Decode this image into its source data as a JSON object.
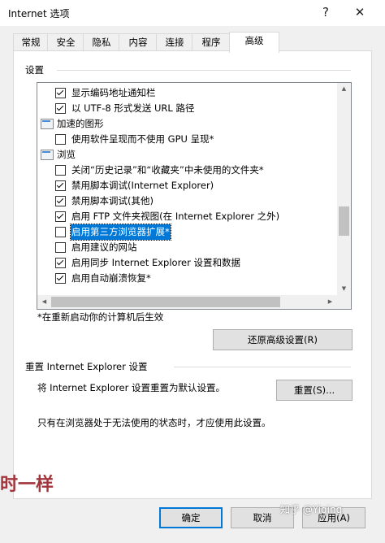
{
  "window": {
    "title": "Internet 选项",
    "help_glyph": "?",
    "close_glyph": "✕"
  },
  "tabs": [
    {
      "label": "常规"
    },
    {
      "label": "安全"
    },
    {
      "label": "隐私"
    },
    {
      "label": "内容"
    },
    {
      "label": "连接"
    },
    {
      "label": "程序"
    },
    {
      "label": "高级",
      "active": true
    }
  ],
  "settings": {
    "group_label": "设置",
    "items": [
      {
        "type": "checkbox",
        "checked": true,
        "label": "显示编码地址通知栏"
      },
      {
        "type": "checkbox",
        "checked": true,
        "label": "以 UTF-8 形式发送 URL 路径"
      },
      {
        "type": "category",
        "label": "加速的图形"
      },
      {
        "type": "checkbox",
        "checked": false,
        "label": "使用软件呈现而不使用 GPU 呈现*"
      },
      {
        "type": "category",
        "label": "浏览"
      },
      {
        "type": "checkbox",
        "checked": false,
        "label": "关闭“历史记录”和“收藏夹”中未使用的文件夹*"
      },
      {
        "type": "checkbox",
        "checked": true,
        "label": "禁用脚本调试(Internet Explorer)"
      },
      {
        "type": "checkbox",
        "checked": true,
        "label": "禁用脚本调试(其他)"
      },
      {
        "type": "checkbox",
        "checked": true,
        "label": "启用 FTP 文件夹视图(在 Internet Explorer 之外)"
      },
      {
        "type": "checkbox",
        "checked": false,
        "label": "启用第三方浏览器扩展*",
        "selected": true
      },
      {
        "type": "checkbox",
        "checked": false,
        "label": "启用建议的网站"
      },
      {
        "type": "checkbox",
        "checked": true,
        "label": "启用同步 Internet Explorer 设置和数据"
      },
      {
        "type": "checkbox",
        "checked": true,
        "label": "启用自动崩溃恢复*"
      }
    ],
    "restart_note": "*在重新启动你的计算机后生效",
    "restore_button": "还原高级设置(R)"
  },
  "reset": {
    "group_label": "重置 Internet Explorer 设置",
    "description": "将 Internet Explorer 设置重置为默认设置。",
    "reset_button": "重置(S)...",
    "note": "只有在浏览器处于无法使用的状态时，才应使用此设置。"
  },
  "footer": {
    "ok_button": "确定",
    "cancel_button": "取消",
    "apply_button": "应用(A)"
  },
  "watermarks": {
    "left_text": "时一样",
    "right_text": "知乎 @Yiqing"
  }
}
